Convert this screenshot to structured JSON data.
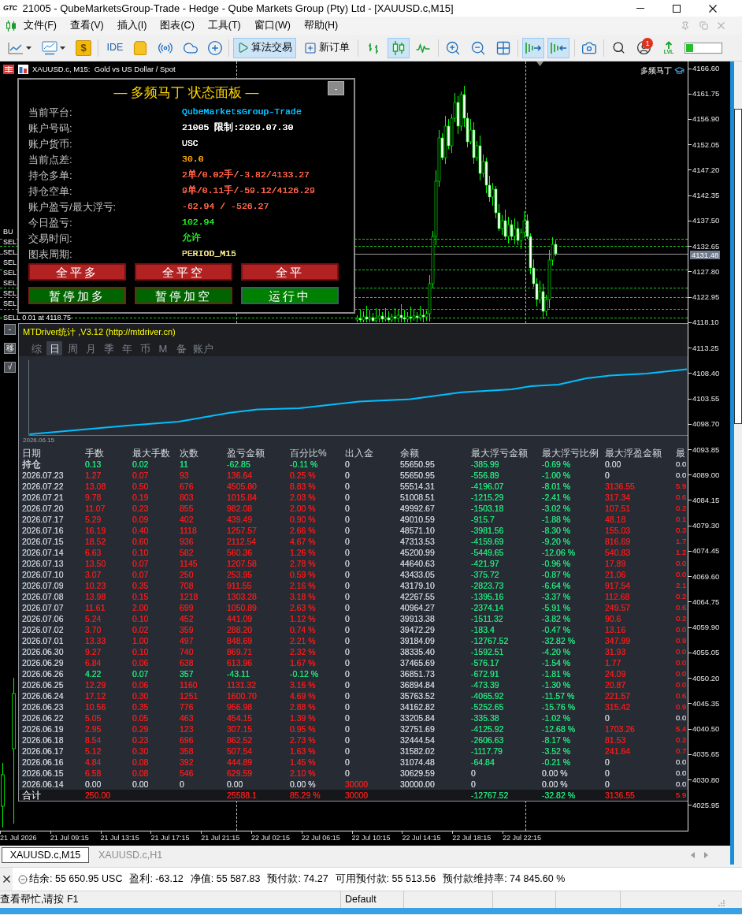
{
  "window": {
    "logo_text": "GTC",
    "title": "21005 - QubeMarketsGroup-Trade - Hedge - Qube Markets Group (Pty) Ltd - [XAUUSD.c,M15]"
  },
  "menu": [
    "文件(F)",
    "查看(V)",
    "插入(I)",
    "图表(C)",
    "工具(T)",
    "窗口(W)",
    "帮助(H)"
  ],
  "toolbar": {
    "market_label": "$",
    "ide_label": "IDE",
    "algo_trading": {
      "label": "算法交易",
      "selected": true
    },
    "new_order_label": "新订单",
    "chart_types": [
      {
        "selected": false
      },
      {
        "selected": true
      },
      {
        "selected": false
      }
    ],
    "auto_scroll": {
      "selected": true
    },
    "chart_shift": {
      "selected": true
    },
    "notification_count": "1",
    "level_label": "LVL"
  },
  "chart": {
    "header": "XAUUSD.c, M15:  Gold vs US Dollar / Spot",
    "expert_name": "多频马丁",
    "order_labels": [
      "BU",
      "SEL",
      "SEL",
      "SEL",
      "SEL",
      "SEL",
      "SEL",
      "SEL"
    ],
    "order_detail": "SELL 0.01 at 4118.75",
    "price_axis": {
      "labels": [
        "4166.60",
        "4161.75",
        "4156.90",
        "4152.05",
        "4147.20",
        "4142.35",
        "4137.50",
        "4132.65",
        "4127.80",
        "4122.95",
        "4118.10",
        "4113.25",
        "4108.40",
        "4103.55",
        "4098.70",
        "4093.85",
        "4089.00",
        "4084.15",
        "4079.30",
        "4074.45",
        "4069.60",
        "4064.75",
        "4059.90",
        "4055.05",
        "4050.20",
        "4045.35",
        "4040.50",
        "4035.65",
        "4030.80",
        "4025.95"
      ],
      "current_price": "4131.48"
    },
    "time_axis": [
      "21 Jul 2026",
      "21 Jul 09:15",
      "21 Jul 13:15",
      "21 Jul 17:15",
      "21 Jul 21:15",
      "22 Jul 02:15",
      "22 Jul 06:15",
      "22 Jul 10:15",
      "22 Jul 14:15",
      "22 Jul 18:15",
      "22 Jul 22:15"
    ]
  },
  "status_panel": {
    "title": "— 多频马丁 状态面板 —",
    "minimize_label": "-",
    "rows": [
      {
        "label": "当前平台:",
        "value": "QubeMarketsGroup-Trade",
        "color": "#00bfff"
      },
      {
        "label": "账户号码:",
        "value": "21005 限制:2029.07.30",
        "color": "#ffffff"
      },
      {
        "label": "账户货币:",
        "value": "USC",
        "color": "#ffffff"
      },
      {
        "label": "当前点差:",
        "value": "30.0",
        "color": "#ffa500"
      },
      {
        "label": "持仓多单:",
        "value": "2单/0.02手/-3.82/4133.27",
        "color": "#ff6347"
      },
      {
        "label": "持仓空单:",
        "value": "9单/0.11手/-59.12/4126.29",
        "color": "#ff6347"
      },
      {
        "label": "账户盈亏/最大浮亏:",
        "value": "-62.94 / -526.27",
        "color": "#ff6347"
      },
      {
        "label": "今日盈亏:",
        "value": "102.94",
        "color": "#22e022"
      },
      {
        "label": "交易时间:",
        "value": "允许",
        "color": "#22e022"
      },
      {
        "label": "图表周期:",
        "value": "PERIOD_M15",
        "color": "#f0e68c"
      }
    ],
    "buttons": [
      {
        "label": "全平多",
        "color": "#b22222",
        "kind": "close"
      },
      {
        "label": "全平空",
        "color": "#b22222",
        "kind": "close"
      },
      {
        "label": "全平",
        "color": "#b22222",
        "kind": "close"
      },
      {
        "label": "暂停加多",
        "color": "#006400",
        "kind": "pause"
      },
      {
        "label": "暂停加空",
        "color": "#006400",
        "kind": "pause"
      },
      {
        "label": "运行中",
        "color": "#008000",
        "kind": "run"
      }
    ]
  },
  "stats_panel": {
    "title": "MTDriver统计 ,V3.12 (http://mtdriver.cn)",
    "side_buttons": [
      "-",
      "移",
      "√"
    ],
    "tabs": [
      {
        "label": "综",
        "selected": false
      },
      {
        "label": "日",
        "selected": true
      },
      {
        "label": "周",
        "selected": false
      },
      {
        "label": "月",
        "selected": false
      },
      {
        "label": "季",
        "selected": false
      },
      {
        "label": "年",
        "selected": false
      },
      {
        "label": "币",
        "selected": false
      },
      {
        "label": "M",
        "selected": false
      },
      {
        "label": "备",
        "selected": false
      },
      {
        "label": "账户",
        "selected": false
      }
    ],
    "equity_start_date": "2026.06.15",
    "columns": [
      "日期",
      "手数",
      "最大手数",
      "次数",
      "盈亏金额",
      "百分比%",
      "出入金",
      "余额",
      "最大浮亏金额",
      "最大浮亏比例",
      "最大浮盈金额",
      "最"
    ],
    "rows": [
      {
        "kind": "position",
        "cells": [
          {
            "text": "持仓",
            "color": "#d4d8de"
          },
          {
            "text": "0.13",
            "color": "#22e27c"
          },
          {
            "text": "0.02",
            "color": "#22e27c"
          },
          {
            "text": "11",
            "color": "#22e27c"
          },
          {
            "text": "-62.85",
            "color": "#22e27c"
          },
          {
            "text": "-0.11 %",
            "color": "#22e27c"
          },
          {
            "text": "0",
            "color": "#c9cdd3"
          },
          {
            "text": "55650.95",
            "color": "#c9cdd3"
          },
          {
            "text": "-385.99",
            "color": "#22e27c"
          },
          {
            "text": "-0.69 %",
            "color": "#22e27c"
          },
          {
            "text": "0.00",
            "color": "#c9cdd3"
          },
          {
            "text": "0.0",
            "color": "#c9cdd3"
          }
        ]
      },
      {
        "kind": "day",
        "cells": [
          {
            "text": "2026.07.23",
            "color": "#c9cdd3"
          },
          {
            "text": "1.27",
            "color": "#f01c1c"
          },
          {
            "text": "0.07",
            "color": "#f01c1c"
          },
          {
            "text": "93",
            "color": "#f01c1c"
          },
          {
            "text": "136.64",
            "color": "#f01c1c"
          },
          {
            "text": "0.25 %",
            "color": "#f01c1c"
          },
          {
            "text": "0",
            "color": "#c9cdd3"
          },
          {
            "text": "55650.95",
            "color": "#c9cdd3"
          },
          {
            "text": "-556.89",
            "color": "#22e27c"
          },
          {
            "text": "-1.00 %",
            "color": "#22e27c"
          },
          {
            "text": "0",
            "color": "#c9cdd3"
          },
          {
            "text": "0.0",
            "color": "#c9cdd3"
          }
        ]
      },
      {
        "kind": "day",
        "cells": [
          {
            "text": "2026.07.22",
            "color": "#c9cdd3"
          },
          {
            "text": "13.08",
            "color": "#f01c1c"
          },
          {
            "text": "0.50",
            "color": "#f01c1c"
          },
          {
            "text": "676",
            "color": "#f01c1c"
          },
          {
            "text": "4505.80",
            "color": "#f01c1c"
          },
          {
            "text": "8.83 %",
            "color": "#f01c1c"
          },
          {
            "text": "0",
            "color": "#c9cdd3"
          },
          {
            "text": "55514.31",
            "color": "#c9cdd3"
          },
          {
            "text": "-4196.07",
            "color": "#22e27c"
          },
          {
            "text": "-8.01 %",
            "color": "#22e27c"
          },
          {
            "text": "3136.55",
            "color": "#f01c1c"
          },
          {
            "text": "5.9",
            "color": "#f01c1c"
          }
        ]
      },
      {
        "kind": "day",
        "cells": [
          {
            "text": "2026.07.21",
            "color": "#c9cdd3"
          },
          {
            "text": "9.78",
            "color": "#f01c1c"
          },
          {
            "text": "0.19",
            "color": "#f01c1c"
          },
          {
            "text": "803",
            "color": "#f01c1c"
          },
          {
            "text": "1015.84",
            "color": "#f01c1c"
          },
          {
            "text": "2.03 %",
            "color": "#f01c1c"
          },
          {
            "text": "0",
            "color": "#c9cdd3"
          },
          {
            "text": "51008.51",
            "color": "#c9cdd3"
          },
          {
            "text": "-1215.29",
            "color": "#22e27c"
          },
          {
            "text": "-2.41 %",
            "color": "#22e27c"
          },
          {
            "text": "317.34",
            "color": "#f01c1c"
          },
          {
            "text": "0.6",
            "color": "#f01c1c"
          }
        ]
      },
      {
        "kind": "day",
        "cells": [
          {
            "text": "2026.07.20",
            "color": "#c9cdd3"
          },
          {
            "text": "11.07",
            "color": "#f01c1c"
          },
          {
            "text": "0.23",
            "color": "#f01c1c"
          },
          {
            "text": "855",
            "color": "#f01c1c"
          },
          {
            "text": "982.08",
            "color": "#f01c1c"
          },
          {
            "text": "2.00 %",
            "color": "#f01c1c"
          },
          {
            "text": "0",
            "color": "#c9cdd3"
          },
          {
            "text": "49992.67",
            "color": "#c9cdd3"
          },
          {
            "text": "-1503.18",
            "color": "#22e27c"
          },
          {
            "text": "-3.02 %",
            "color": "#22e27c"
          },
          {
            "text": "107.51",
            "color": "#f01c1c"
          },
          {
            "text": "0.2",
            "color": "#f01c1c"
          }
        ]
      },
      {
        "kind": "day",
        "cells": [
          {
            "text": "2026.07.17",
            "color": "#c9cdd3"
          },
          {
            "text": "5.29",
            "color": "#f01c1c"
          },
          {
            "text": "0.09",
            "color": "#f01c1c"
          },
          {
            "text": "402",
            "color": "#f01c1c"
          },
          {
            "text": "439.49",
            "color": "#f01c1c"
          },
          {
            "text": "0.90 %",
            "color": "#f01c1c"
          },
          {
            "text": "0",
            "color": "#c9cdd3"
          },
          {
            "text": "49010.59",
            "color": "#c9cdd3"
          },
          {
            "text": "-915.7",
            "color": "#22e27c"
          },
          {
            "text": "-1.88 %",
            "color": "#22e27c"
          },
          {
            "text": "48.18",
            "color": "#f01c1c"
          },
          {
            "text": "0.1",
            "color": "#f01c1c"
          }
        ]
      },
      {
        "kind": "day",
        "cells": [
          {
            "text": "2026.07.16",
            "color": "#c9cdd3"
          },
          {
            "text": "16.19",
            "color": "#f01c1c"
          },
          {
            "text": "0.40",
            "color": "#f01c1c"
          },
          {
            "text": "1118",
            "color": "#f01c1c"
          },
          {
            "text": "1257.57",
            "color": "#f01c1c"
          },
          {
            "text": "2.66 %",
            "color": "#f01c1c"
          },
          {
            "text": "0",
            "color": "#c9cdd3"
          },
          {
            "text": "48571.10",
            "color": "#c9cdd3"
          },
          {
            "text": "-3981.56",
            "color": "#22e27c"
          },
          {
            "text": "-8.30 %",
            "color": "#22e27c"
          },
          {
            "text": "155.03",
            "color": "#f01c1c"
          },
          {
            "text": "0.3",
            "color": "#f01c1c"
          }
        ]
      },
      {
        "kind": "day",
        "cells": [
          {
            "text": "2026.07.15",
            "color": "#c9cdd3"
          },
          {
            "text": "18.52",
            "color": "#f01c1c"
          },
          {
            "text": "0.60",
            "color": "#f01c1c"
          },
          {
            "text": "936",
            "color": "#f01c1c"
          },
          {
            "text": "2112.54",
            "color": "#f01c1c"
          },
          {
            "text": "4.67 %",
            "color": "#f01c1c"
          },
          {
            "text": "0",
            "color": "#c9cdd3"
          },
          {
            "text": "47313.53",
            "color": "#c9cdd3"
          },
          {
            "text": "-4159.69",
            "color": "#22e27c"
          },
          {
            "text": "-9.20 %",
            "color": "#22e27c"
          },
          {
            "text": "816.69",
            "color": "#f01c1c"
          },
          {
            "text": "1.7",
            "color": "#f01c1c"
          }
        ]
      },
      {
        "kind": "day",
        "cells": [
          {
            "text": "2026.07.14",
            "color": "#c9cdd3"
          },
          {
            "text": "6.63",
            "color": "#f01c1c"
          },
          {
            "text": "0.10",
            "color": "#f01c1c"
          },
          {
            "text": "582",
            "color": "#f01c1c"
          },
          {
            "text": "560.36",
            "color": "#f01c1c"
          },
          {
            "text": "1.26 %",
            "color": "#f01c1c"
          },
          {
            "text": "0",
            "color": "#c9cdd3"
          },
          {
            "text": "45200.99",
            "color": "#c9cdd3"
          },
          {
            "text": "-5449.65",
            "color": "#22e27c"
          },
          {
            "text": "-12.06 %",
            "color": "#22e27c"
          },
          {
            "text": "540.83",
            "color": "#f01c1c"
          },
          {
            "text": "1.2",
            "color": "#f01c1c"
          }
        ]
      },
      {
        "kind": "day",
        "cells": [
          {
            "text": "2026.07.13",
            "color": "#c9cdd3"
          },
          {
            "text": "13.50",
            "color": "#f01c1c"
          },
          {
            "text": "0.07",
            "color": "#f01c1c"
          },
          {
            "text": "1145",
            "color": "#f01c1c"
          },
          {
            "text": "1207.58",
            "color": "#f01c1c"
          },
          {
            "text": "2.78 %",
            "color": "#f01c1c"
          },
          {
            "text": "0",
            "color": "#c9cdd3"
          },
          {
            "text": "44640.63",
            "color": "#c9cdd3"
          },
          {
            "text": "-421.97",
            "color": "#22e27c"
          },
          {
            "text": "-0.96 %",
            "color": "#22e27c"
          },
          {
            "text": "17.89",
            "color": "#f01c1c"
          },
          {
            "text": "0.0",
            "color": "#f01c1c"
          }
        ]
      },
      {
        "kind": "day",
        "cells": [
          {
            "text": "2026.07.10",
            "color": "#c9cdd3"
          },
          {
            "text": "3.07",
            "color": "#f01c1c"
          },
          {
            "text": "0.07",
            "color": "#f01c1c"
          },
          {
            "text": "250",
            "color": "#f01c1c"
          },
          {
            "text": "253.95",
            "color": "#f01c1c"
          },
          {
            "text": "0.59 %",
            "color": "#f01c1c"
          },
          {
            "text": "0",
            "color": "#c9cdd3"
          },
          {
            "text": "43433.05",
            "color": "#c9cdd3"
          },
          {
            "text": "-375.72",
            "color": "#22e27c"
          },
          {
            "text": "-0.87 %",
            "color": "#22e27c"
          },
          {
            "text": "21.06",
            "color": "#f01c1c"
          },
          {
            "text": "0.0",
            "color": "#f01c1c"
          }
        ]
      },
      {
        "kind": "day",
        "cells": [
          {
            "text": "2026.07.09",
            "color": "#c9cdd3"
          },
          {
            "text": "10.23",
            "color": "#f01c1c"
          },
          {
            "text": "0.35",
            "color": "#f01c1c"
          },
          {
            "text": "708",
            "color": "#f01c1c"
          },
          {
            "text": "911.55",
            "color": "#f01c1c"
          },
          {
            "text": "2.16 %",
            "color": "#f01c1c"
          },
          {
            "text": "0",
            "color": "#c9cdd3"
          },
          {
            "text": "43179.10",
            "color": "#c9cdd3"
          },
          {
            "text": "-2823.73",
            "color": "#22e27c"
          },
          {
            "text": "-6.64 %",
            "color": "#22e27c"
          },
          {
            "text": "917.54",
            "color": "#f01c1c"
          },
          {
            "text": "2.1",
            "color": "#f01c1c"
          }
        ]
      },
      {
        "kind": "day",
        "cells": [
          {
            "text": "2026.07.08",
            "color": "#c9cdd3"
          },
          {
            "text": "13.98",
            "color": "#f01c1c"
          },
          {
            "text": "0.15",
            "color": "#f01c1c"
          },
          {
            "text": "1218",
            "color": "#f01c1c"
          },
          {
            "text": "1303.28",
            "color": "#f01c1c"
          },
          {
            "text": "3.18 %",
            "color": "#f01c1c"
          },
          {
            "text": "0",
            "color": "#c9cdd3"
          },
          {
            "text": "42267.55",
            "color": "#c9cdd3"
          },
          {
            "text": "-1395.16",
            "color": "#22e27c"
          },
          {
            "text": "-3.37 %",
            "color": "#22e27c"
          },
          {
            "text": "112.68",
            "color": "#f01c1c"
          },
          {
            "text": "0.2",
            "color": "#f01c1c"
          }
        ]
      },
      {
        "kind": "day",
        "cells": [
          {
            "text": "2026.07.07",
            "color": "#c9cdd3"
          },
          {
            "text": "11.61",
            "color": "#f01c1c"
          },
          {
            "text": "2.00",
            "color": "#f01c1c"
          },
          {
            "text": "699",
            "color": "#f01c1c"
          },
          {
            "text": "1050.89",
            "color": "#f01c1c"
          },
          {
            "text": "2.63 %",
            "color": "#f01c1c"
          },
          {
            "text": "0",
            "color": "#c9cdd3"
          },
          {
            "text": "40964.27",
            "color": "#c9cdd3"
          },
          {
            "text": "-2374.14",
            "color": "#22e27c"
          },
          {
            "text": "-5.91 %",
            "color": "#22e27c"
          },
          {
            "text": "249.57",
            "color": "#f01c1c"
          },
          {
            "text": "0.6",
            "color": "#f01c1c"
          }
        ]
      },
      {
        "kind": "day",
        "cells": [
          {
            "text": "2026.07.06",
            "color": "#c9cdd3"
          },
          {
            "text": "5.24",
            "color": "#f01c1c"
          },
          {
            "text": "0.10",
            "color": "#f01c1c"
          },
          {
            "text": "452",
            "color": "#f01c1c"
          },
          {
            "text": "441.09",
            "color": "#f01c1c"
          },
          {
            "text": "1.12 %",
            "color": "#f01c1c"
          },
          {
            "text": "0",
            "color": "#c9cdd3"
          },
          {
            "text": "39913.38",
            "color": "#c9cdd3"
          },
          {
            "text": "-1511.32",
            "color": "#22e27c"
          },
          {
            "text": "-3.82 %",
            "color": "#22e27c"
          },
          {
            "text": "90.6",
            "color": "#f01c1c"
          },
          {
            "text": "0.2",
            "color": "#f01c1c"
          }
        ]
      },
      {
        "kind": "day",
        "cells": [
          {
            "text": "2026.07.02",
            "color": "#c9cdd3"
          },
          {
            "text": "3.70",
            "color": "#f01c1c"
          },
          {
            "text": "0.02",
            "color": "#f01c1c"
          },
          {
            "text": "359",
            "color": "#f01c1c"
          },
          {
            "text": "288.20",
            "color": "#f01c1c"
          },
          {
            "text": "0.74 %",
            "color": "#f01c1c"
          },
          {
            "text": "0",
            "color": "#c9cdd3"
          },
          {
            "text": "39472.29",
            "color": "#c9cdd3"
          },
          {
            "text": "-183.4",
            "color": "#22e27c"
          },
          {
            "text": "-0.47 %",
            "color": "#22e27c"
          },
          {
            "text": "13.16",
            "color": "#f01c1c"
          },
          {
            "text": "0.0",
            "color": "#f01c1c"
          }
        ]
      },
      {
        "kind": "day",
        "cells": [
          {
            "text": "2026.07.01",
            "color": "#c9cdd3"
          },
          {
            "text": "13.33",
            "color": "#f01c1c"
          },
          {
            "text": "1.00",
            "color": "#f01c1c"
          },
          {
            "text": "497",
            "color": "#f01c1c"
          },
          {
            "text": "848.69",
            "color": "#f01c1c"
          },
          {
            "text": "2.21 %",
            "color": "#f01c1c"
          },
          {
            "text": "0",
            "color": "#c9cdd3"
          },
          {
            "text": "39184.09",
            "color": "#c9cdd3"
          },
          {
            "text": "-12767.52",
            "color": "#22e27c"
          },
          {
            "text": "-32.82 %",
            "color": "#22e27c"
          },
          {
            "text": "347.99",
            "color": "#f01c1c"
          },
          {
            "text": "0.9",
            "color": "#f01c1c"
          }
        ]
      },
      {
        "kind": "day",
        "cells": [
          {
            "text": "2026.06.30",
            "color": "#c9cdd3"
          },
          {
            "text": "9.27",
            "color": "#f01c1c"
          },
          {
            "text": "0.10",
            "color": "#f01c1c"
          },
          {
            "text": "740",
            "color": "#f01c1c"
          },
          {
            "text": "869.71",
            "color": "#f01c1c"
          },
          {
            "text": "2.32 %",
            "color": "#f01c1c"
          },
          {
            "text": "0",
            "color": "#c9cdd3"
          },
          {
            "text": "38335.40",
            "color": "#c9cdd3"
          },
          {
            "text": "-1592.51",
            "color": "#22e27c"
          },
          {
            "text": "-4.20 %",
            "color": "#22e27c"
          },
          {
            "text": "31.93",
            "color": "#f01c1c"
          },
          {
            "text": "0.0",
            "color": "#f01c1c"
          }
        ]
      },
      {
        "kind": "day",
        "cells": [
          {
            "text": "2026.06.29",
            "color": "#c9cdd3"
          },
          {
            "text": "6.84",
            "color": "#f01c1c"
          },
          {
            "text": "0.06",
            "color": "#f01c1c"
          },
          {
            "text": "638",
            "color": "#f01c1c"
          },
          {
            "text": "613.96",
            "color": "#f01c1c"
          },
          {
            "text": "1.67 %",
            "color": "#f01c1c"
          },
          {
            "text": "0",
            "color": "#c9cdd3"
          },
          {
            "text": "37465.69",
            "color": "#c9cdd3"
          },
          {
            "text": "-576.17",
            "color": "#22e27c"
          },
          {
            "text": "-1.54 %",
            "color": "#22e27c"
          },
          {
            "text": "1.77",
            "color": "#f01c1c"
          },
          {
            "text": "0.0",
            "color": "#f01c1c"
          }
        ]
      },
      {
        "kind": "day",
        "cells": [
          {
            "text": "2026.06.26",
            "color": "#c9cdd3"
          },
          {
            "text": "4.22",
            "color": "#22e27c"
          },
          {
            "text": "0.07",
            "color": "#22e27c"
          },
          {
            "text": "357",
            "color": "#22e27c"
          },
          {
            "text": "-43.11",
            "color": "#22e27c"
          },
          {
            "text": "-0.12 %",
            "color": "#22e27c"
          },
          {
            "text": "0",
            "color": "#c9cdd3"
          },
          {
            "text": "36851.73",
            "color": "#c9cdd3"
          },
          {
            "text": "-672.91",
            "color": "#22e27c"
          },
          {
            "text": "-1.81 %",
            "color": "#22e27c"
          },
          {
            "text": "24.09",
            "color": "#f01c1c"
          },
          {
            "text": "0.0",
            "color": "#f01c1c"
          }
        ]
      },
      {
        "kind": "day",
        "cells": [
          {
            "text": "2026.06.25",
            "color": "#c9cdd3"
          },
          {
            "text": "12.29",
            "color": "#f01c1c"
          },
          {
            "text": "0.06",
            "color": "#f01c1c"
          },
          {
            "text": "1160",
            "color": "#f01c1c"
          },
          {
            "text": "1131.32",
            "color": "#f01c1c"
          },
          {
            "text": "3.16 %",
            "color": "#f01c1c"
          },
          {
            "text": "0",
            "color": "#c9cdd3"
          },
          {
            "text": "36894.84",
            "color": "#c9cdd3"
          },
          {
            "text": "-473.39",
            "color": "#22e27c"
          },
          {
            "text": "-1.30 %",
            "color": "#22e27c"
          },
          {
            "text": "20.87",
            "color": "#f01c1c"
          },
          {
            "text": "0.0",
            "color": "#f01c1c"
          }
        ]
      },
      {
        "kind": "day",
        "cells": [
          {
            "text": "2026.06.24",
            "color": "#c9cdd3"
          },
          {
            "text": "17.12",
            "color": "#f01c1c"
          },
          {
            "text": "0.30",
            "color": "#f01c1c"
          },
          {
            "text": "1251",
            "color": "#f01c1c"
          },
          {
            "text": "1600.70",
            "color": "#f01c1c"
          },
          {
            "text": "4.69 %",
            "color": "#f01c1c"
          },
          {
            "text": "0",
            "color": "#c9cdd3"
          },
          {
            "text": "35763.52",
            "color": "#c9cdd3"
          },
          {
            "text": "-4065.92",
            "color": "#22e27c"
          },
          {
            "text": "-11.57 %",
            "color": "#22e27c"
          },
          {
            "text": "221.57",
            "color": "#f01c1c"
          },
          {
            "text": "0.6",
            "color": "#f01c1c"
          }
        ]
      },
      {
        "kind": "day",
        "cells": [
          {
            "text": "2026.06.23",
            "color": "#c9cdd3"
          },
          {
            "text": "10.56",
            "color": "#f01c1c"
          },
          {
            "text": "0.35",
            "color": "#f01c1c"
          },
          {
            "text": "776",
            "color": "#f01c1c"
          },
          {
            "text": "956.98",
            "color": "#f01c1c"
          },
          {
            "text": "2.88 %",
            "color": "#f01c1c"
          },
          {
            "text": "0",
            "color": "#c9cdd3"
          },
          {
            "text": "34162.82",
            "color": "#c9cdd3"
          },
          {
            "text": "-5252.65",
            "color": "#22e27c"
          },
          {
            "text": "-15.76 %",
            "color": "#22e27c"
          },
          {
            "text": "315.42",
            "color": "#f01c1c"
          },
          {
            "text": "0.9",
            "color": "#f01c1c"
          }
        ]
      },
      {
        "kind": "day",
        "cells": [
          {
            "text": "2026.06.22",
            "color": "#c9cdd3"
          },
          {
            "text": "5.05",
            "color": "#f01c1c"
          },
          {
            "text": "0.05",
            "color": "#f01c1c"
          },
          {
            "text": "463",
            "color": "#f01c1c"
          },
          {
            "text": "454.15",
            "color": "#f01c1c"
          },
          {
            "text": "1.39 %",
            "color": "#f01c1c"
          },
          {
            "text": "0",
            "color": "#c9cdd3"
          },
          {
            "text": "33205.84",
            "color": "#c9cdd3"
          },
          {
            "text": "-335.38",
            "color": "#22e27c"
          },
          {
            "text": "-1.02 %",
            "color": "#22e27c"
          },
          {
            "text": "0",
            "color": "#c9cdd3"
          },
          {
            "text": "0.0",
            "color": "#c9cdd3"
          }
        ]
      },
      {
        "kind": "day",
        "cells": [
          {
            "text": "2026.06.19",
            "color": "#c9cdd3"
          },
          {
            "text": "2.95",
            "color": "#f01c1c"
          },
          {
            "text": "0.29",
            "color": "#f01c1c"
          },
          {
            "text": "123",
            "color": "#f01c1c"
          },
          {
            "text": "307.15",
            "color": "#f01c1c"
          },
          {
            "text": "0.95 %",
            "color": "#f01c1c"
          },
          {
            "text": "0",
            "color": "#c9cdd3"
          },
          {
            "text": "32751.69",
            "color": "#c9cdd3"
          },
          {
            "text": "-4125.92",
            "color": "#22e27c"
          },
          {
            "text": "-12.68 %",
            "color": "#22e27c"
          },
          {
            "text": "1703.26",
            "color": "#f01c1c"
          },
          {
            "text": "5.4",
            "color": "#f01c1c"
          }
        ]
      },
      {
        "kind": "day",
        "cells": [
          {
            "text": "2026.06.18",
            "color": "#c9cdd3"
          },
          {
            "text": "8.54",
            "color": "#f01c1c"
          },
          {
            "text": "0.23",
            "color": "#f01c1c"
          },
          {
            "text": "696",
            "color": "#f01c1c"
          },
          {
            "text": "862.52",
            "color": "#f01c1c"
          },
          {
            "text": "2.73 %",
            "color": "#f01c1c"
          },
          {
            "text": "0",
            "color": "#c9cdd3"
          },
          {
            "text": "32444.54",
            "color": "#c9cdd3"
          },
          {
            "text": "-2606.63",
            "color": "#22e27c"
          },
          {
            "text": "-8.17 %",
            "color": "#22e27c"
          },
          {
            "text": "81.53",
            "color": "#f01c1c"
          },
          {
            "text": "0.2",
            "color": "#f01c1c"
          }
        ]
      },
      {
        "kind": "day",
        "cells": [
          {
            "text": "2026.06.17",
            "color": "#c9cdd3"
          },
          {
            "text": "5.12",
            "color": "#f01c1c"
          },
          {
            "text": "0.30",
            "color": "#f01c1c"
          },
          {
            "text": "358",
            "color": "#f01c1c"
          },
          {
            "text": "507.54",
            "color": "#f01c1c"
          },
          {
            "text": "1.63 %",
            "color": "#f01c1c"
          },
          {
            "text": "0",
            "color": "#c9cdd3"
          },
          {
            "text": "31582.02",
            "color": "#c9cdd3"
          },
          {
            "text": "-1117.79",
            "color": "#22e27c"
          },
          {
            "text": "-3.52 %",
            "color": "#22e27c"
          },
          {
            "text": "241.64",
            "color": "#f01c1c"
          },
          {
            "text": "0.7",
            "color": "#f01c1c"
          }
        ]
      },
      {
        "kind": "day",
        "cells": [
          {
            "text": "2026.06.16",
            "color": "#c9cdd3"
          },
          {
            "text": "4.84",
            "color": "#f01c1c"
          },
          {
            "text": "0.08",
            "color": "#f01c1c"
          },
          {
            "text": "392",
            "color": "#f01c1c"
          },
          {
            "text": "444.89",
            "color": "#f01c1c"
          },
          {
            "text": "1.45 %",
            "color": "#f01c1c"
          },
          {
            "text": "0",
            "color": "#c9cdd3"
          },
          {
            "text": "31074.48",
            "color": "#c9cdd3"
          },
          {
            "text": "-64.84",
            "color": "#22e27c"
          },
          {
            "text": "-0.21 %",
            "color": "#22e27c"
          },
          {
            "text": "0",
            "color": "#c9cdd3"
          },
          {
            "text": "0.0",
            "color": "#c9cdd3"
          }
        ]
      },
      {
        "kind": "day",
        "cells": [
          {
            "text": "2026.06.15",
            "color": "#c9cdd3"
          },
          {
            "text": "6.58",
            "color": "#f01c1c"
          },
          {
            "text": "0.08",
            "color": "#f01c1c"
          },
          {
            "text": "546",
            "color": "#f01c1c"
          },
          {
            "text": "629.59",
            "color": "#f01c1c"
          },
          {
            "text": "2.10 %",
            "color": "#f01c1c"
          },
          {
            "text": "0",
            "color": "#c9cdd3"
          },
          {
            "text": "30629.59",
            "color": "#c9cdd3"
          },
          {
            "text": "0",
            "color": "#c9cdd3"
          },
          {
            "text": "0.00 %",
            "color": "#c9cdd3"
          },
          {
            "text": "0",
            "color": "#c9cdd3"
          },
          {
            "text": "0.0",
            "color": "#c9cdd3"
          }
        ]
      },
      {
        "kind": "day",
        "cells": [
          {
            "text": "2026.06.14",
            "color": "#c9cdd3"
          },
          {
            "text": "0.00",
            "color": "#c9cdd3"
          },
          {
            "text": "0.00",
            "color": "#c9cdd3"
          },
          {
            "text": "0",
            "color": "#c9cdd3"
          },
          {
            "text": "0.00",
            "color": "#c9cdd3"
          },
          {
            "text": "0.00 %",
            "color": "#c9cdd3"
          },
          {
            "text": "30000",
            "color": "#f01c1c"
          },
          {
            "text": "30000.00",
            "color": "#c9cdd3"
          },
          {
            "text": "0",
            "color": "#c9cdd3"
          },
          {
            "text": "0.00 %",
            "color": "#c9cdd3"
          },
          {
            "text": "0",
            "color": "#c9cdd3"
          },
          {
            "text": "0.0",
            "color": "#c9cdd3"
          }
        ]
      },
      {
        "kind": "total",
        "cells": [
          {
            "text": "合计",
            "color": "#d4d8de"
          },
          {
            "text": "250.00",
            "color": "#f01c1c"
          },
          "",
          "",
          {
            "text": "25588.1",
            "color": "#f01c1c"
          },
          {
            "text": "85.29 %",
            "color": "#f01c1c"
          },
          {
            "text": "30000",
            "color": "#f01c1c"
          },
          "",
          {
            "text": "-12767.52",
            "color": "#22e27c"
          },
          {
            "text": "-32.82 %",
            "color": "#22e27c"
          },
          {
            "text": "3136.55",
            "color": "#f01c1c"
          },
          {
            "text": "5.9",
            "color": "#f01c1c"
          }
        ]
      }
    ]
  },
  "chart_tabs": [
    {
      "label": "XAUUSD.c,M15",
      "selected": true
    },
    {
      "label": "XAUUSD.c,H1",
      "selected": false
    }
  ],
  "account_bar": [
    {
      "label": "结余:",
      "value": "55 650.95 USC"
    },
    {
      "label": "盈利:",
      "value": "-63.12"
    },
    {
      "label": "净值:",
      "value": "55 587.83"
    },
    {
      "label": "预付款:",
      "value": "74.27"
    },
    {
      "label": "可用预付款:",
      "value": "55 513.56"
    },
    {
      "label": "预付款维持率:",
      "value": "74 845.60 %"
    }
  ],
  "status_bar": {
    "help": "查看帮忙,请按 F1",
    "profile": "Default"
  }
}
